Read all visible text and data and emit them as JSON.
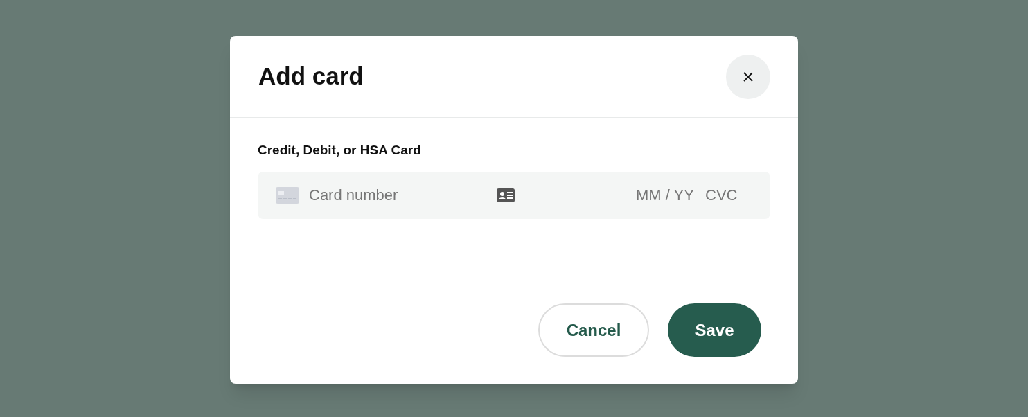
{
  "dialog": {
    "title": "Add card",
    "field": {
      "label": "Credit, Debit, or HSA Card",
      "number_placeholder": "Card number",
      "expiry_placeholder": "MM / YY",
      "cvc_placeholder": "CVC"
    },
    "buttons": [
      {
        "label": "Cancel",
        "kind": "secondary"
      },
      {
        "label": "Save",
        "kind": "primary"
      }
    ]
  }
}
